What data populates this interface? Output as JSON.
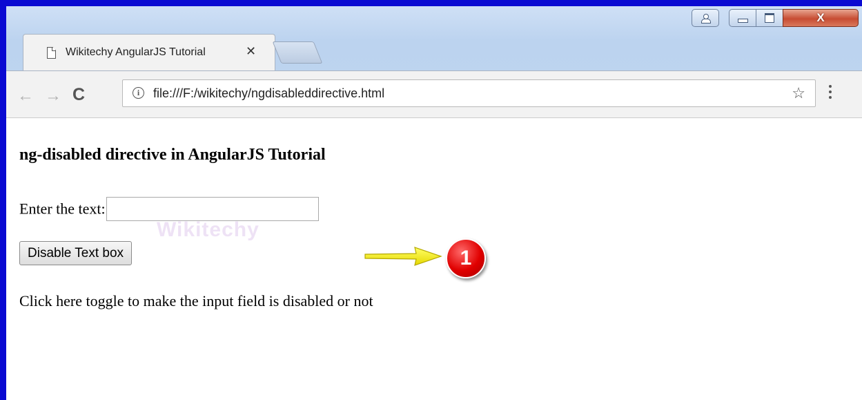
{
  "browser": {
    "tab": {
      "title": "Wikitechy AngularJS Tutorial",
      "close_glyph": "✕",
      "icon": "page-icon"
    },
    "nav": {
      "back_glyph": "←",
      "forward_glyph": "→",
      "reload_glyph": "C"
    },
    "address": {
      "info_glyph": "i",
      "url": "file:///F:/wikitechy/ngdisableddirective.html"
    },
    "bookmark_glyph": "☆",
    "window_controls": {
      "close_glyph": "X"
    }
  },
  "page": {
    "title": "ng-disabled directive in AngularJS Tutorial",
    "input_label": "Enter the text:",
    "input_value": "",
    "button_label": "Disable Text box",
    "note": "Click here toggle to make the input field is disabled or not",
    "watermark": "Wikitechy"
  },
  "annotation": {
    "marker": "1",
    "arrow_color": "#f5f500",
    "marker_color": "#e00000"
  },
  "colors": {
    "frame": "#0a0ad2",
    "chrome": "#f2f2f2"
  }
}
